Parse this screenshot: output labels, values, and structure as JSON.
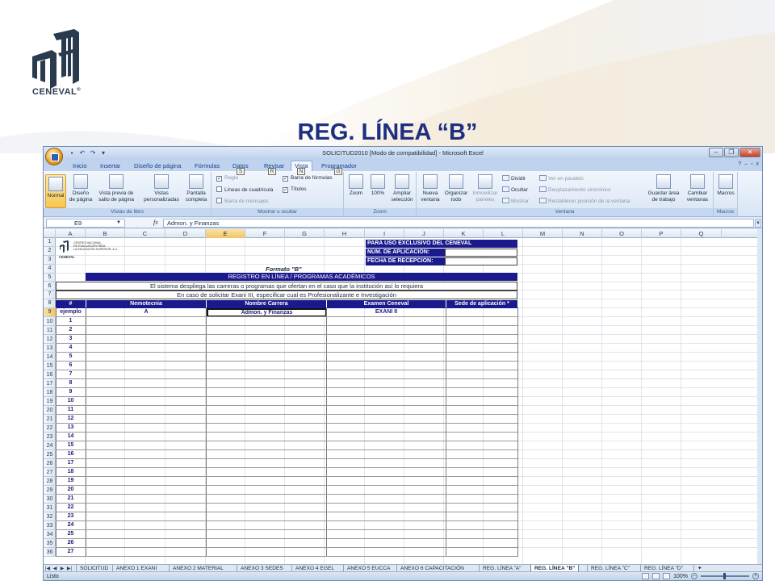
{
  "slide": {
    "title": "REG. LÍNEA “B”",
    "logo_text": "CENEVAL",
    "logo_reg": "®"
  },
  "excel": {
    "window_title": "SOLICITUD2010  [Modo de compatibilidad]  -  Microsoft Excel",
    "tabs": [
      "Inicio",
      "Insertar",
      "Diseño de página",
      "Fórmulas",
      "Datos",
      "Revisar",
      "Vista",
      "Programador"
    ],
    "active_tab": "Vista",
    "keytips": [
      "S",
      "R",
      "N",
      "G"
    ],
    "ribbon": {
      "vistas": {
        "label": "Vistas de libro",
        "normal": "Normal",
        "diseno": [
          "Diseño",
          "de página"
        ],
        "vista_previa": [
          "Vista previa de",
          "salto de página"
        ],
        "vistas_pers": [
          "Vistas",
          "personalizadas"
        ],
        "pantalla": [
          "Pantalla",
          "completa"
        ]
      },
      "mostrar": {
        "label": "Mostrar u ocultar",
        "regla": "Regla",
        "lineas": "Líneas de cuadrícula",
        "barra_mensajes": "Barra de mensajes",
        "barra_formulas": "Barra de fórmulas",
        "titulos": "Títulos"
      },
      "zoom": {
        "label": "Zoom",
        "zoom": "Zoom",
        "cien": "100%",
        "ampliar": [
          "Ampliar",
          "selección"
        ]
      },
      "ventana": {
        "label": "Ventana",
        "nueva": [
          "Nueva",
          "ventana"
        ],
        "organizar": [
          "Organizar",
          "todo"
        ],
        "inmovilizar": [
          "Inmovilizar",
          "paneles"
        ],
        "dividir": "Dividir",
        "ocultar": "Ocultar",
        "mostrar": "Mostrar",
        "ver_paralelo": "Ver en paralelo",
        "desplaz": "Desplazamiento sincrónico",
        "restablecer": "Restablecer posición de la ventana",
        "guardar": [
          "Guardar área",
          "de trabajo"
        ],
        "cambiar": [
          "Cambiar",
          "ventanas"
        ]
      },
      "macros": {
        "label": "Macros",
        "macros": "Macros"
      }
    },
    "formula_bar": {
      "name_box": "E9",
      "fx": "fx",
      "value": "Admon. y Finanzas"
    },
    "columns": [
      "A",
      "B",
      "C",
      "D",
      "E",
      "F",
      "G",
      "H",
      "I",
      "J",
      "K",
      "L",
      "M",
      "N",
      "O",
      "P",
      "Q"
    ],
    "selected_column": "E",
    "selected_row": "9",
    "rows": [
      "1",
      "2",
      "3",
      "4",
      "5",
      "6",
      "7",
      "8",
      "9",
      "10",
      "11",
      "12",
      "13",
      "14",
      "15",
      "16",
      "17",
      "18",
      "19",
      "20",
      "21",
      "22",
      "23",
      "24",
      "25",
      "26",
      "27",
      "28",
      "29",
      "30",
      "31",
      "32",
      "33",
      "34",
      "35",
      "36"
    ],
    "sheet": {
      "ceneval_logo_lines": [
        "CENTRO NACIONAL",
        "DE EVALUACIÓN PARA",
        "LA EDUCACIÓN SUPERIOR, A.C."
      ],
      "ceneval_logo_word": "CENEVAL",
      "uso_exclusivo": "PARA USO EXCLUSIVO DEL CENEVAL",
      "num_aplicacion": "NÚM. DE APLICACIÓN:",
      "fecha_recepcion": "FECHA DE RECEPCIÓN:",
      "formato": "Formato \"B\"",
      "registro": "REGISTRO EN LÍNEA / PROGRAMAS ACADÉMICOS",
      "info1": "El sistema despliega las carreras o programas que ofertan en el caso que la institución así lo requiera",
      "info2": "En caso de solicitar Exani III, especificar cual es Profesionalizante e Investigación",
      "headers": [
        "#",
        "Nemotecnia",
        "Nombre Carrera",
        "Examen Ceneval",
        "Sede de aplicación *"
      ],
      "example": [
        "ejemplo",
        "A",
        "Admon. y Finanzas",
        "EXANI II",
        ""
      ],
      "numbers": [
        "1",
        "2",
        "3",
        "4",
        "5",
        "6",
        "7",
        "8",
        "9",
        "10",
        "11",
        "12",
        "13",
        "14",
        "15",
        "16",
        "17",
        "18",
        "19",
        "20",
        "21",
        "22",
        "23",
        "24",
        "25",
        "26",
        "27"
      ]
    },
    "sheet_tabs": [
      "SOLICITUD",
      "ANEXO 1 EXANI",
      "ANEXO 2 MATERIAL",
      "ANEXO 3 SEDES",
      "ANEXO 4 EGEL",
      "ANEXO 5 EUCCA",
      "ANEXO 6 CAPACITACIÓN",
      "REG. LÍNEA \"A\"",
      "REG. LÍNEA \"B\"",
      "REG. LÍNEA \"C\"",
      "REG. LÍNEA \"D\""
    ],
    "active_sheet": "REG. LÍNEA \"B\"",
    "status": "Listo",
    "zoom_level": "100%"
  }
}
